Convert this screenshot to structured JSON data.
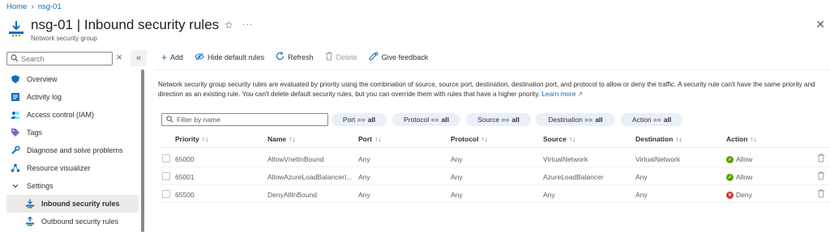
{
  "breadcrumb": {
    "home": "Home",
    "current": "nsg-01"
  },
  "header": {
    "title": "nsg-01 | Inbound security rules",
    "subtitle": "Network security group"
  },
  "sidebar": {
    "search_placeholder": "Search",
    "items": [
      {
        "label": "Overview",
        "icon": "shield-icon"
      },
      {
        "label": "Activity log",
        "icon": "activity-log-icon"
      },
      {
        "label": "Access control (IAM)",
        "icon": "people-icon"
      },
      {
        "label": "Tags",
        "icon": "tag-icon"
      },
      {
        "label": "Diagnose and solve problems",
        "icon": "wrench-icon"
      },
      {
        "label": "Resource visualizer",
        "icon": "visualizer-icon"
      },
      {
        "label": "Settings",
        "icon": "chevron-down-icon"
      },
      {
        "label": "Inbound security rules",
        "icon": "inbound-icon",
        "active": true
      },
      {
        "label": "Outbound security rules",
        "icon": "outbound-icon"
      }
    ]
  },
  "toolbar": {
    "add": "Add",
    "hide_default": "Hide default rules",
    "refresh": "Refresh",
    "delete": "Delete",
    "feedback": "Give feedback"
  },
  "description": {
    "text": "Network security group security rules are evaluated by priority using the combination of source, source port, destination, destination port, and protocol to allow or deny the traffic. A security rule can't have the same priority and direction as an existing rule. You can't delete default security rules, but you can override them with rules that have a higher priority.",
    "link": "Learn more"
  },
  "filters": {
    "placeholder": "Filter by name",
    "pills": [
      {
        "label": "Port ==",
        "value": "all"
      },
      {
        "label": "Protocol ==",
        "value": "all"
      },
      {
        "label": "Source ==",
        "value": "all"
      },
      {
        "label": "Destination ==",
        "value": "all"
      },
      {
        "label": "Action ==",
        "value": "all"
      }
    ]
  },
  "table": {
    "columns": [
      "Priority",
      "Name",
      "Port",
      "Protocol",
      "Source",
      "Destination",
      "Action"
    ],
    "rows": [
      {
        "priority": "65000",
        "name": "AllowVnetInBound",
        "port": "Any",
        "protocol": "Any",
        "source": "VirtualNetwork",
        "destination": "VirtualNetwork",
        "action": "Allow"
      },
      {
        "priority": "65001",
        "name": "AllowAzureLoadBalancerI...",
        "port": "Any",
        "protocol": "Any",
        "source": "AzureLoadBalancer",
        "destination": "Any",
        "action": "Allow"
      },
      {
        "priority": "65500",
        "name": "DenyAllInBound",
        "port": "Any",
        "protocol": "Any",
        "source": "Any",
        "destination": "Any",
        "action": "Deny"
      }
    ]
  },
  "colors": {
    "accent": "#0f6cbd",
    "allow": "#57a300",
    "deny": "#d13438"
  }
}
